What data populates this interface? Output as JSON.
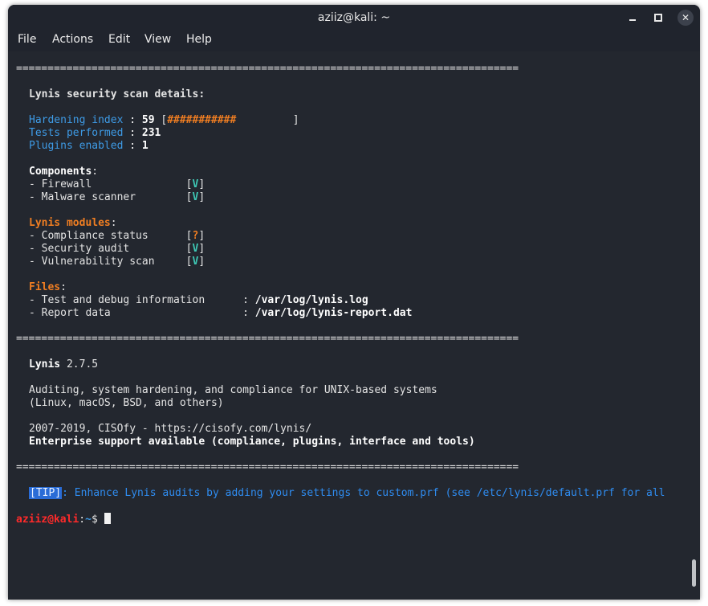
{
  "window": {
    "title": "aziiz@kali: ~",
    "controls": {
      "minimize": "minimize-icon",
      "maximize": "maximize-icon",
      "close": "close-icon",
      "close_glyph": "✕"
    }
  },
  "menubar": {
    "items": [
      "File",
      "Actions",
      "Edit",
      "View",
      "Help"
    ]
  },
  "terminal": {
    "separator": "================================================================================",
    "details_heading": "Lynis security scan details:",
    "hardening": {
      "label": "Hardening index",
      "sep": " : ",
      "value": "59",
      "bar_open": " [",
      "bar_fill": "###########",
      "bar_rest": "         ]"
    },
    "tests": {
      "label": "Tests performed",
      "sep": " : ",
      "value": "231"
    },
    "plugins": {
      "label": "Plugins enabled",
      "sep": " : ",
      "value": "1"
    },
    "components": {
      "heading": "Components",
      "colon": ":",
      "items": [
        {
          "label": "- Firewall               ",
          "status": "V"
        },
        {
          "label": "- Malware scanner        ",
          "status": "V"
        }
      ]
    },
    "modules": {
      "heading": "Lynis modules",
      "colon": ":",
      "items": [
        {
          "label": "- Compliance status      ",
          "status": "?"
        },
        {
          "label": "- Security audit         ",
          "status": "V"
        },
        {
          "label": "- Vulnerability scan     ",
          "status": "V"
        }
      ]
    },
    "files": {
      "heading": "Files",
      "colon": ":",
      "items": [
        {
          "label": "- Test and debug information      : ",
          "path": "/var/log/lynis.log"
        },
        {
          "label": "- Report data                     : ",
          "path": "/var/log/lynis-report.dat"
        }
      ]
    },
    "about": {
      "product": "Lynis",
      "version": " 2.7.5",
      "desc1": "Auditing, system hardening, and compliance for UNIX-based systems",
      "desc2": "(Linux, macOS, BSD, and others)",
      "copyright": "2007-2019, CISOfy - https://cisofy.com/lynis/",
      "enterprise": "Enterprise support available (compliance, plugins, interface and tools)"
    },
    "tip": {
      "tag": "[TIP]",
      "text": ": Enhance Lynis audits by adding your settings to custom.prf (see /etc/lynis/default.prf for all"
    },
    "prompt": {
      "user_host": "aziiz@kali",
      "colon": ":",
      "path": "~",
      "symbol": "$ "
    }
  },
  "colors": {
    "terminal_bg": "#23272f",
    "label_blue": "#3e9be6",
    "accent_orange": "#f07e22",
    "ok_teal": "#3ec7b4",
    "prompt_red": "#ff2a2a",
    "tip_blue": "#2f8cf0"
  },
  "scrollbar": {
    "position_fraction": 0.94
  }
}
